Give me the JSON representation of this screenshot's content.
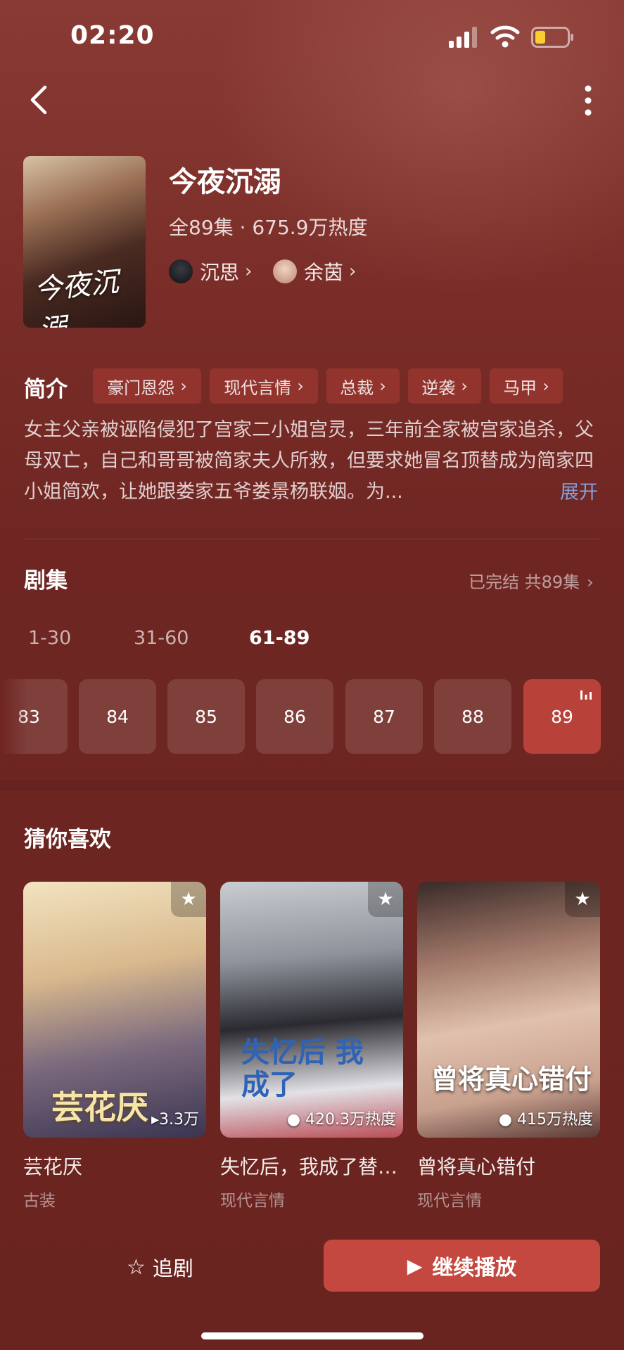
{
  "status_bar": {
    "time": "02:20"
  },
  "drama": {
    "title": "今夜沉溺",
    "cover_text": "今夜沉溺",
    "meta": "全89集 · 675.9万热度",
    "actors": [
      {
        "name": "沉思"
      },
      {
        "name": "余茵"
      }
    ]
  },
  "intro": {
    "label": "简介",
    "tags": [
      "豪门恩怨",
      "现代言情",
      "总裁",
      "逆袭",
      "马甲"
    ],
    "description": "女主父亲被诬陷侵犯了宫家二小姐宫灵，三年前全家被宫家追杀，父母双亡，自己和哥哥被简家夫人所救，但要求她冒名顶替成为简家四小姐简欢，让她跟娄家五爷娄景杨联姻。为...",
    "expand": "展开"
  },
  "episodes": {
    "label": "剧集",
    "status": "已完结 共89集",
    "ranges": [
      "1-30",
      "31-60",
      "61-89"
    ],
    "active_range": 2,
    "items": [
      "83",
      "84",
      "85",
      "86",
      "87",
      "88",
      "89"
    ],
    "active_item": "89"
  },
  "recommend": {
    "label": "猜你喜欢",
    "items": [
      {
        "name": "芸花厌",
        "genre": "古装",
        "heat": "3.3万",
        "overlay": "芸花厌"
      },
      {
        "name": "失忆后，我成了替…",
        "genre": "现代言情",
        "heat": "420.3万热度",
        "overlay": "失忆后 我成了"
      },
      {
        "name": "曾将真心错付",
        "genre": "现代言情",
        "heat": "415万热度",
        "overlay": "曾将真心错付"
      }
    ]
  },
  "bottom": {
    "follow": "追剧",
    "play": "继续播放"
  },
  "colors": {
    "accent": "#c4483f",
    "background": "#6e2521",
    "link": "#7fa2e0"
  }
}
